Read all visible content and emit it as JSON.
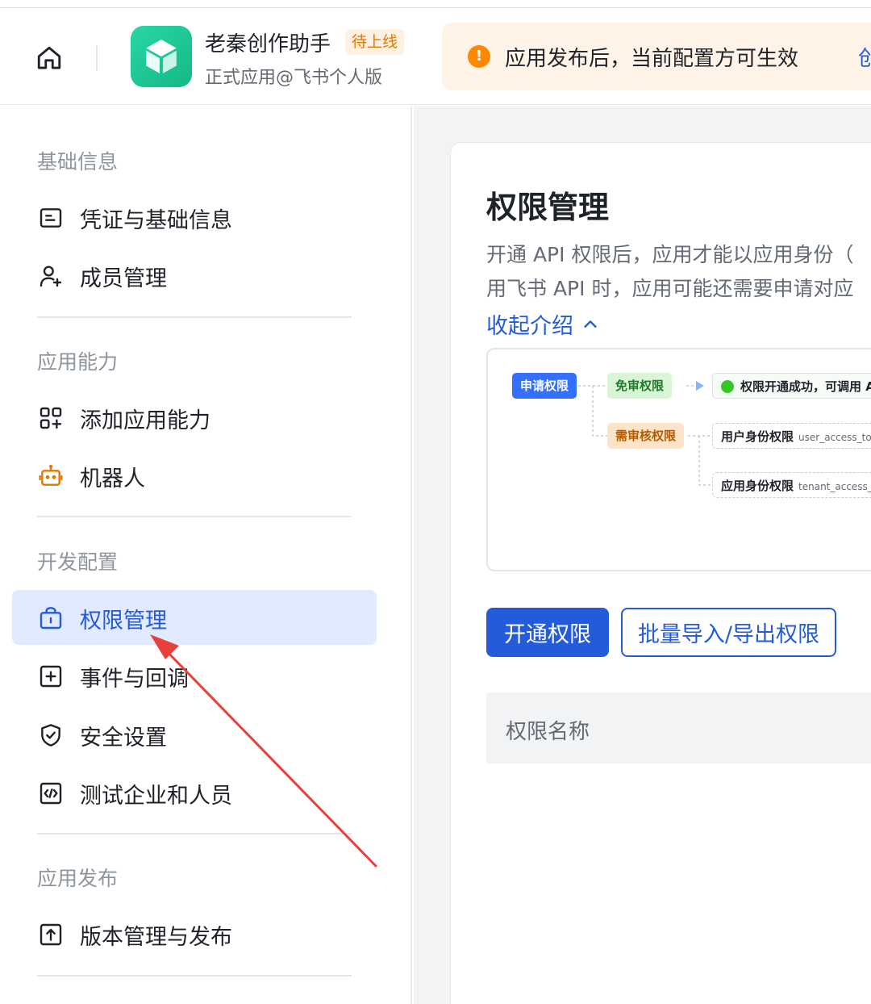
{
  "header": {
    "app_name": "老秦创作助手",
    "badge": "待上线",
    "app_sub": "正式应用@飞书个人版",
    "notice_text": "应用发布后，当前配置方可生效",
    "notice_link": "创",
    "notice_icon": "!"
  },
  "sidebar": {
    "groups": [
      {
        "title": "基础信息",
        "items": [
          {
            "label": "凭证与基础信息",
            "icon": "id-card-icon"
          },
          {
            "label": "成员管理",
            "icon": "add-member-icon"
          }
        ]
      },
      {
        "title": "应用能力",
        "items": [
          {
            "label": "添加应用能力",
            "icon": "grid-add-icon"
          },
          {
            "label": "机器人",
            "icon": "robot-icon"
          }
        ]
      },
      {
        "title": "开发配置",
        "items": [
          {
            "label": "权限管理",
            "icon": "lock-bag-icon",
            "active": true
          },
          {
            "label": "事件与回调",
            "icon": "plus-box-icon"
          },
          {
            "label": "安全设置",
            "icon": "shield-check-icon"
          },
          {
            "label": "测试企业和人员",
            "icon": "code-box-icon"
          }
        ]
      },
      {
        "title": "应用发布",
        "items": [
          {
            "label": "版本管理与发布",
            "icon": "upload-box-icon"
          }
        ]
      }
    ]
  },
  "main": {
    "title": "权限管理",
    "desc_line1": "开通 API 权限后，应用才能以应用身份（",
    "desc_line2": "用飞书 API 时，应用可能还需要申请对应",
    "collapse_label": "收起介绍",
    "flow": {
      "apply": "申请权限",
      "free": "免审权限",
      "review": "需审核权限",
      "success": "权限开通成功，可调用 A",
      "user_identity": "用户身份权限",
      "user_token": "user_access_to",
      "tenant_identity": "应用身份权限",
      "tenant_token": "tenant_access_"
    },
    "btn_enable": "开通权限",
    "btn_batch": "批量导入/导出权限",
    "table_header": "权限名称"
  },
  "colors": {
    "accent": "#245bdb",
    "active_bg": "#e1eaff",
    "notice_bg": "#fef3e6",
    "warning": "#ff8800",
    "annotation_arrow": "#e8413b"
  }
}
